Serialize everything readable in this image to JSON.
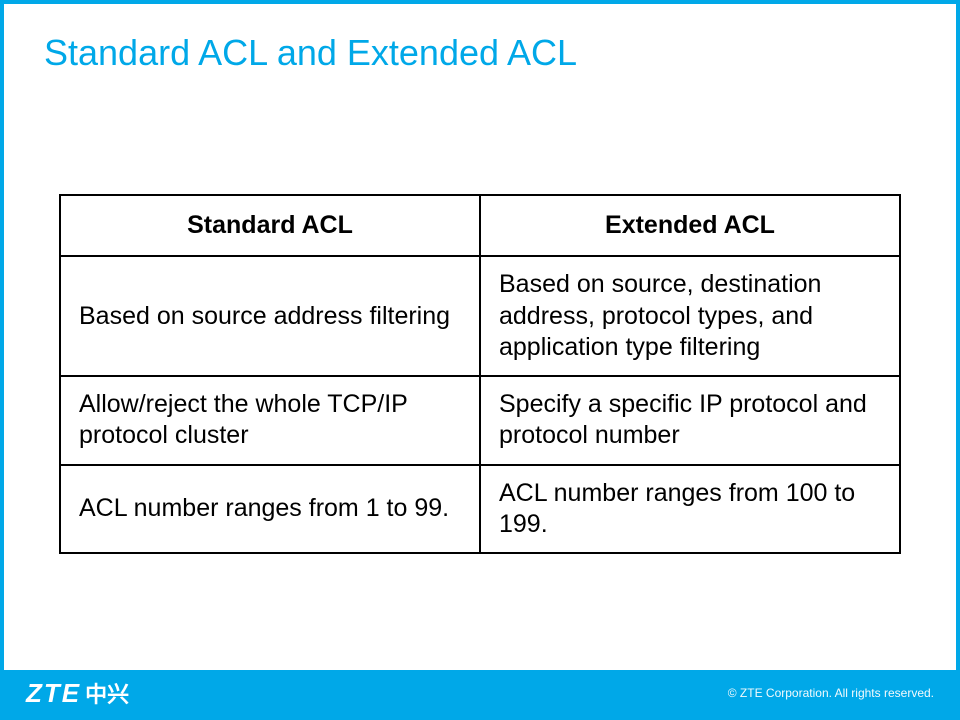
{
  "title": "Standard ACL and Extended ACL",
  "table": {
    "headers": [
      "Standard ACL",
      "Extended ACL"
    ],
    "rows": [
      [
        "Based on source address filtering",
        "Based on source, destination address, protocol types, and application type filtering"
      ],
      [
        "Allow/reject the whole TCP/IP protocol cluster",
        "Specify a specific IP protocol and protocol number"
      ],
      [
        "ACL number ranges from 1 to 99.",
        "ACL number ranges from 100 to 199."
      ]
    ]
  },
  "footer": {
    "logo_en": "ZTE",
    "logo_cn": "中兴",
    "copyright": "© ZTE Corporation. All rights reserved."
  }
}
